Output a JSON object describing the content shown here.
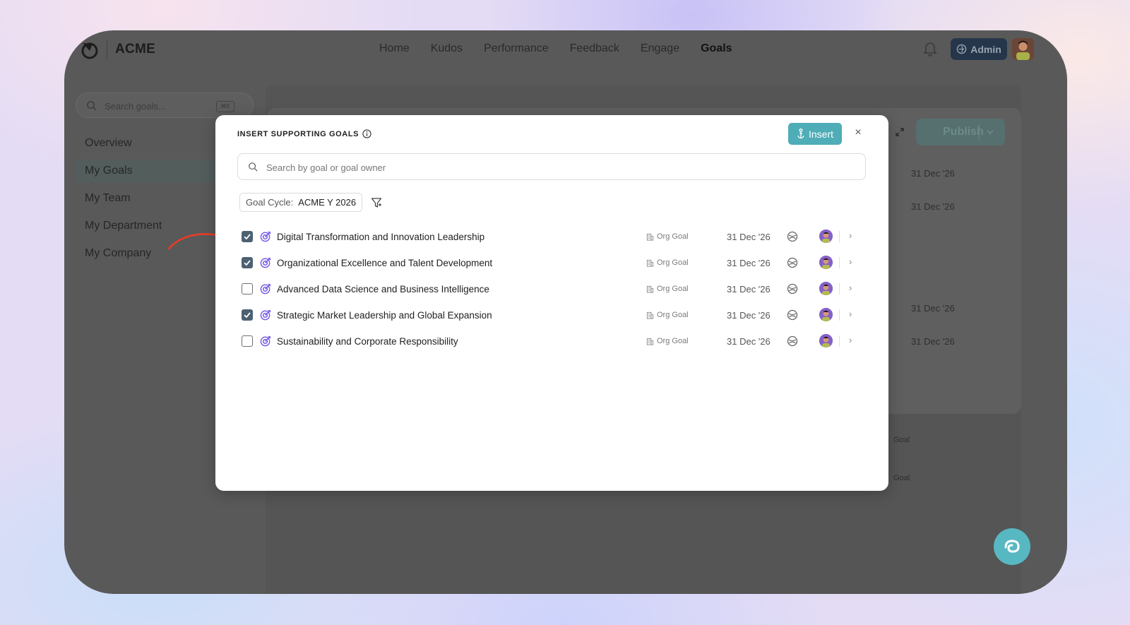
{
  "app": {
    "brand": "ACME",
    "nav": [
      "Home",
      "Kudos",
      "Performance",
      "Feedback",
      "Engage",
      "Goals"
    ],
    "active_nav": "Goals",
    "admin_label": "Admin"
  },
  "sidebar": {
    "search_placeholder": "Search goals...",
    "shortcut": "⌘K",
    "items": [
      "Overview",
      "My Goals",
      "My Team",
      "My Department",
      "My Company"
    ],
    "active": "My Goals"
  },
  "background": {
    "publish_label": "Publish",
    "dates": [
      "31 Dec '26",
      "31 Dec '26",
      "31 Dec '26",
      "31 Dec '26"
    ],
    "goal_type": "Goal"
  },
  "modal": {
    "title": "INSERT SUPPORTING GOALS",
    "insert_label": "Insert",
    "close_label": "×",
    "search_placeholder": "Search by goal or goal owner",
    "cycle_label": "Goal Cycle:",
    "cycle_value": "ACME Y 2026",
    "goals": [
      {
        "title": "Digital Transformation and Innovation Leadership",
        "type": "Org Goal",
        "date": "31 Dec '26",
        "checked": true
      },
      {
        "title": "Organizational Excellence and Talent Development",
        "type": "Org Goal",
        "date": "31 Dec '26",
        "checked": true
      },
      {
        "title": "Advanced Data Science and Business Intelligence",
        "type": "Org Goal",
        "date": "31 Dec '26",
        "checked": false
      },
      {
        "title": "Strategic Market Leadership and Global Expansion",
        "type": "Org Goal",
        "date": "31 Dec '26",
        "checked": true
      },
      {
        "title": "Sustainability and Corporate Responsibility",
        "type": "Org Goal",
        "date": "31 Dec '26",
        "checked": false
      }
    ]
  },
  "colors": {
    "accent": "#4eadb7",
    "checkbox_checked": "#4c6172",
    "goal_icon": "#7b5ee6",
    "annotation_arrow": "#ef3b24"
  }
}
